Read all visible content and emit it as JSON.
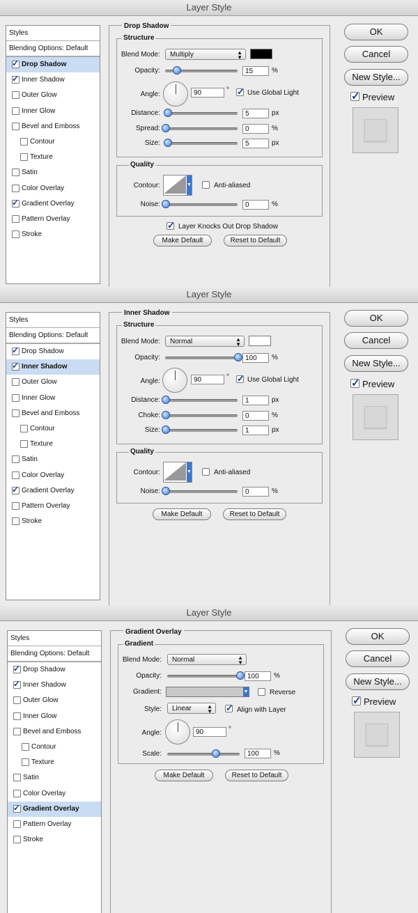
{
  "dialogs": [
    {
      "title": "Layer Style",
      "section": "Drop Shadow",
      "styles_header": "Styles",
      "blending_options": "Blending Options: Default",
      "style_items": [
        {
          "label": "Drop Shadow",
          "checked": true,
          "active": true,
          "indent": false
        },
        {
          "label": "Inner Shadow",
          "checked": true,
          "active": false,
          "indent": false
        },
        {
          "label": "Outer Glow",
          "checked": false,
          "active": false,
          "indent": false
        },
        {
          "label": "Inner Glow",
          "checked": false,
          "active": false,
          "indent": false
        },
        {
          "label": "Bevel and Emboss",
          "checked": false,
          "active": false,
          "indent": false
        },
        {
          "label": "Contour",
          "checked": false,
          "active": false,
          "indent": true
        },
        {
          "label": "Texture",
          "checked": false,
          "active": false,
          "indent": true
        },
        {
          "label": "Satin",
          "checked": false,
          "active": false,
          "indent": false
        },
        {
          "label": "Color Overlay",
          "checked": false,
          "active": false,
          "indent": false
        },
        {
          "label": "Gradient Overlay",
          "checked": true,
          "active": false,
          "indent": false
        },
        {
          "label": "Pattern Overlay",
          "checked": false,
          "active": false,
          "indent": false
        },
        {
          "label": "Stroke",
          "checked": false,
          "active": false,
          "indent": false
        }
      ],
      "structure": {
        "group_title": "Structure",
        "blend_mode_label": "Blend Mode:",
        "blend_mode_value": "Multiply",
        "color": "#000000",
        "opacity_label": "Opacity:",
        "opacity_value": "15",
        "opacity_level": 0.15,
        "opacity_unit": "%",
        "angle_label": "Angle:",
        "angle_value": "90",
        "angle_unit": "°",
        "global_light_label": "Use Global Light",
        "global_light_checked": true,
        "distance_label": "Distance:",
        "distance_value": "5",
        "distance_level": 0.03,
        "distance_unit": "px",
        "third_label": "Spread:",
        "third_value": "0",
        "third_level": 0.0,
        "third_unit": "%",
        "size_label": "Size:",
        "size_value": "5",
        "size_level": 0.03,
        "size_unit": "px"
      },
      "quality": {
        "group_title": "Quality",
        "contour_label": "Contour:",
        "anti_aliased_label": "Anti-aliased",
        "noise_label": "Noise:",
        "noise_value": "0",
        "noise_level": 0.0,
        "noise_unit": "%"
      },
      "knocks_out_label": "Layer Knocks Out Drop Shadow",
      "make_default": "Make Default",
      "reset_default": "Reset to Default",
      "buttons": {
        "ok": "OK",
        "cancel": "Cancel",
        "new_style": "New Style...",
        "preview": "Preview"
      }
    },
    {
      "title": "Layer Style",
      "section": "Inner Shadow",
      "styles_header": "Styles",
      "blending_options": "Blending Options: Default",
      "style_items": [
        {
          "label": "Drop Shadow",
          "checked": true,
          "active": false,
          "indent": false
        },
        {
          "label": "Inner Shadow",
          "checked": true,
          "active": true,
          "indent": false
        },
        {
          "label": "Outer Glow",
          "checked": false,
          "active": false,
          "indent": false
        },
        {
          "label": "Inner Glow",
          "checked": false,
          "active": false,
          "indent": false
        },
        {
          "label": "Bevel and Emboss",
          "checked": false,
          "active": false,
          "indent": false
        },
        {
          "label": "Contour",
          "checked": false,
          "active": false,
          "indent": true
        },
        {
          "label": "Texture",
          "checked": false,
          "active": false,
          "indent": true
        },
        {
          "label": "Satin",
          "checked": false,
          "active": false,
          "indent": false
        },
        {
          "label": "Color Overlay",
          "checked": false,
          "active": false,
          "indent": false
        },
        {
          "label": "Gradient Overlay",
          "checked": true,
          "active": false,
          "indent": false
        },
        {
          "label": "Pattern Overlay",
          "checked": false,
          "active": false,
          "indent": false
        },
        {
          "label": "Stroke",
          "checked": false,
          "active": false,
          "indent": false
        }
      ],
      "structure": {
        "group_title": "Structure",
        "blend_mode_label": "Blend Mode:",
        "blend_mode_value": "Normal",
        "color": "#ffffff",
        "opacity_label": "Opacity:",
        "opacity_value": "100",
        "opacity_level": 1.0,
        "opacity_unit": "%",
        "angle_label": "Angle:",
        "angle_value": "90",
        "angle_unit": "°",
        "global_light_label": "Use Global Light",
        "global_light_checked": true,
        "distance_label": "Distance:",
        "distance_value": "1",
        "distance_level": 0.0,
        "distance_unit": "px",
        "third_label": "Choke:",
        "third_value": "0",
        "third_level": 0.0,
        "third_unit": "%",
        "size_label": "Size:",
        "size_value": "1",
        "size_level": 0.0,
        "size_unit": "px"
      },
      "quality": {
        "group_title": "Quality",
        "contour_label": "Contour:",
        "anti_aliased_label": "Anti-aliased",
        "noise_label": "Noise:",
        "noise_value": "0",
        "noise_level": 0.0,
        "noise_unit": "%"
      },
      "make_default": "Make Default",
      "reset_default": "Reset to Default",
      "buttons": {
        "ok": "OK",
        "cancel": "Cancel",
        "new_style": "New Style...",
        "preview": "Preview"
      }
    },
    {
      "title": "Layer Style",
      "section": "Gradient Overlay",
      "styles_header": "Styles",
      "blending_options": "Blending Options: Default",
      "style_items": [
        {
          "label": "Drop Shadow",
          "checked": true,
          "active": false,
          "indent": false
        },
        {
          "label": "Inner Shadow",
          "checked": true,
          "active": false,
          "indent": false
        },
        {
          "label": "Outer Glow",
          "checked": false,
          "active": false,
          "indent": false
        },
        {
          "label": "Inner Glow",
          "checked": false,
          "active": false,
          "indent": false
        },
        {
          "label": "Bevel and Emboss",
          "checked": false,
          "active": false,
          "indent": false
        },
        {
          "label": "Contour",
          "checked": false,
          "active": false,
          "indent": true
        },
        {
          "label": "Texture",
          "checked": false,
          "active": false,
          "indent": true
        },
        {
          "label": "Satin",
          "checked": false,
          "active": false,
          "indent": false
        },
        {
          "label": "Color Overlay",
          "checked": false,
          "active": false,
          "indent": false
        },
        {
          "label": "Gradient Overlay",
          "checked": true,
          "active": true,
          "indent": false
        },
        {
          "label": "Pattern Overlay",
          "checked": false,
          "active": false,
          "indent": false
        },
        {
          "label": "Stroke",
          "checked": false,
          "active": false,
          "indent": false
        }
      ],
      "gradient": {
        "group_title": "Gradient",
        "blend_mode_label": "Blend Mode:",
        "blend_mode_value": "Normal",
        "opacity_label": "Opacity:",
        "opacity_value": "100",
        "opacity_level": 1.0,
        "opacity_unit": "%",
        "gradient_label": "Gradient:",
        "gradient_color": "#c8c8c8",
        "reverse_label": "Reverse",
        "style_label": "Style:",
        "style_value": "Linear",
        "align_label": "Align with Layer",
        "angle_label": "Angle:",
        "angle_value": "90",
        "angle_unit": "°",
        "scale_label": "Scale:",
        "scale_value": "100",
        "scale_level": 0.666,
        "scale_unit": "%"
      },
      "make_default": "Make Default",
      "reset_default": "Reset to Default",
      "buttons": {
        "ok": "OK",
        "cancel": "Cancel",
        "new_style": "New Style...",
        "preview": "Preview"
      }
    }
  ]
}
